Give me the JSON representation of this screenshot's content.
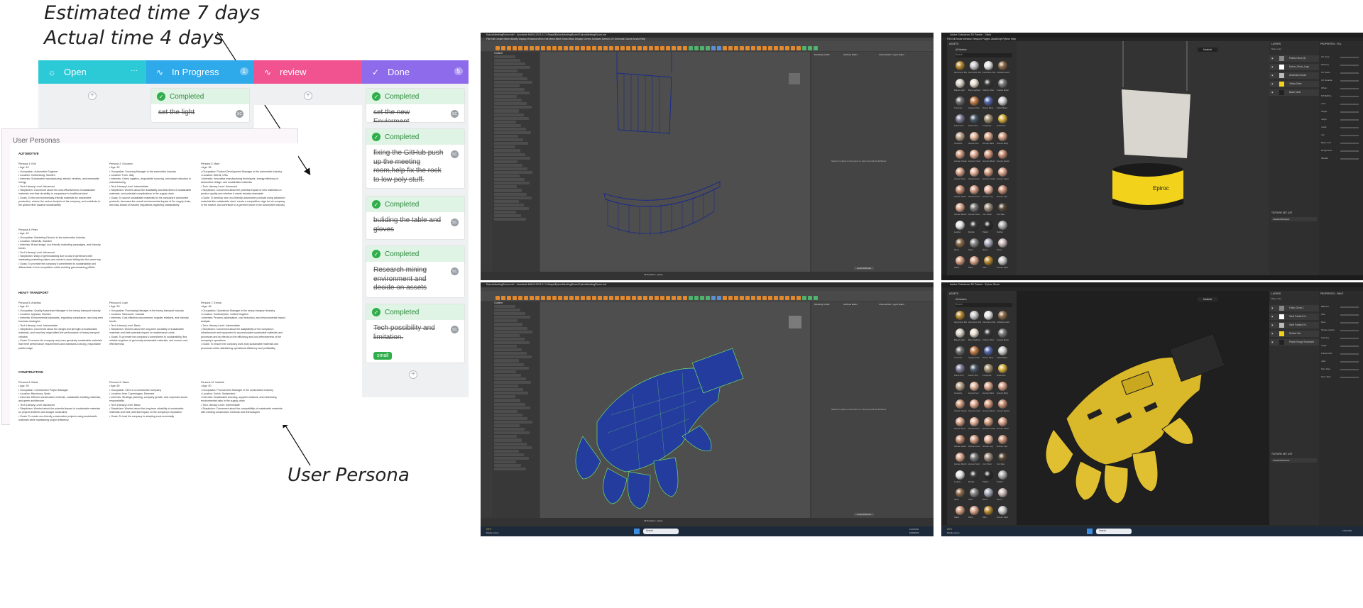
{
  "annotations": {
    "estimated": "Estimated time  7 days",
    "actual": "Actual time 4 days",
    "persona_caption": "User Persona"
  },
  "kanban": {
    "columns": [
      {
        "title": "Open",
        "count": "",
        "color": "#2cc9d6",
        "icon": "sun-icon",
        "menu": "···"
      },
      {
        "title": "In Progress",
        "count": "1",
        "color": "#2ea9ea",
        "icon": "activity-icon"
      },
      {
        "title": "review",
        "count": "",
        "color": "#f0538f",
        "icon": "activity-icon"
      },
      {
        "title": "Done",
        "count": "5",
        "color": "#8e6bea",
        "icon": "check-circle-icon"
      }
    ],
    "status_label": "Completed",
    "in_progress_card": "set the light",
    "done_cards": [
      "set the new Enviorment",
      "fixing the GitHub push up the meeting room,help fix the rock to low poly stuff.",
      "buliding the table and gloves",
      "Research mining environment and decide on assets",
      "Tech possibility and limitation."
    ],
    "tag": "small",
    "avatar": "SC",
    "accent_check": "#2fae4b"
  },
  "personas_doc": {
    "title": "User Personas",
    "sections": [
      {
        "name": "AUTOMOTIVE",
        "personas": [
          {
            "head": "Persona 1: Erik",
            "lines": [
              "Age: 43",
              "Occupation: Automotive Engineer",
              "Location: Gothenburg, Sweden",
              "Interests: Sustainable manufacturing, electric vehicles, and renewable energy",
              "Tech Literacy Level: Advanced",
              "Skepticism: Concerned about the cost-effectiveness of sustainable materials and their durability in comparison to traditional steel",
              "Goals: To find environmentally-friendly materials for automotive production, reduce the carbon footprint of his company, and contribute to the global effort towards sustainability"
            ]
          },
          {
            "head": "Persona 2: Giovanni",
            "lines": [
              "Age: 52",
              "Occupation: Sourcing Manager in the automotive industry",
              "Location: Turin, Italy",
              "Interests: Green logistics, responsible sourcing, and waste reduction in manufacturing",
              "Tech Literacy Level: Intermediate",
              "Skepticism: Worried about the availability and lead times of sustainable materials, and potential complications in the supply chain",
              "Goals: To source sustainable materials for his company's automotive products, decrease the overall environmental impact of the supply chain, and stay ahead of industry regulations regarding sustainability"
            ]
          },
          {
            "head": "Persona 3: Mark",
            "lines": [
              "Age: 38",
              "Occupation: Product Development Manager in the automotive industry",
              "Location: Detroit, USA",
              "Interests: Innovative manufacturing techniques, energy efficiency in automotive design, and sustainable materials",
              "Tech Literacy Level: Advanced",
              "Skepticism: Concerned about the potential impact of new materials on product quality and whether it meets industry standards",
              "Goals: To develop new, eco-friendly automotive products using advanced materials like sustainable steel, create a competitive edge for his company in the market, and contribute to a greener future in the automotive industry"
            ]
          },
          {
            "head": "Persona 4: Peter",
            "lines": [
              "Age: 49",
              "Occupation: Marketing Director in the automotive industry",
              "Location: Västerås, Sweden",
              "Interests: Brand image, eco-friendly marketing campaigns, and industry trends",
              "Tech Literacy Level: Advanced",
              "Skepticism: Wary of greenwashing due to past experiences with misleading marketing claims and wants to avoid falling into the same trap",
              "Goals: To promote the company's commitment to sustainability and differentiate it from competitors while avoiding greenwashing pitfalls"
            ]
          }
        ]
      },
      {
        "name": "HEAVY TRANSPORT",
        "personas": [
          {
            "head": "Persona 5: Andreas",
            "lines": [
              "Age: 44",
              "Occupation: Quality Assurance Manager in the heavy transport industry",
              "Location: Uppsala, Sweden",
              "Interests: Environmental standards, regulatory compliance, and long-term business strategies",
              "Tech Literacy Level: Intermediate",
              "Skepticism: Concerned about the weight and strength of sustainable materials, and how they might affect the performance of heavy transport vehicles",
              "Goals: To ensure his company only uses genuinely sustainable materials that meet performance requirements and maintains a strong, responsible public image"
            ]
          },
          {
            "head": "Persona 6: Liam",
            "lines": [
              "Age: 53",
              "Occupation: Purchasing Manager in the heavy transport industry",
              "Location: Vancouver, Canada",
              "Interests: Cost-effective procurement, supplier relations, and industry trends",
              "Tech Literacy Level: Basic",
              "Skepticism: Worried about the long-term durability of sustainable materials and their potential impact on maintenance costs",
              "Goals: To promote the company's commitment to sustainability, find reliable suppliers of genuinely sustainable materials, and ensure cost-effectiveness"
            ]
          },
          {
            "head": "Persona 7: Emma",
            "lines": [
              "Age: 46",
              "Occupation: Operations Manager in the heavy transport industry",
              "Location: Southampton, United Kingdom",
              "Interests: Process optimization, cost reduction, and environmental impact analysis",
              "Tech Literacy Level: Intermediate",
              "Skepticism: Concerned about the adaptability of the company's infrastructure and equipment to accommodate sustainable materials and processes and its effects on the efficiency and cost-effectiveness of the company's operations",
              "Goals: To ensure her company uses truly sustainable materials and processes while maintaining operational efficiency and profitability"
            ]
          }
        ]
      },
      {
        "name": "CONSTRUCTION",
        "personas": [
          {
            "head": "Persona 8: Maria",
            "lines": [
              "Age: 39",
              "Occupation: Construction Project Manager",
              "Location: Barcelona, Spain",
              "Interests: Efficient construction methods, sustainable building materials, and green architecture",
              "Tech Literacy Level: Advanced",
              "Skepticism: Worried about the potential impact of sustainable materials on project timelines and budget constraints",
              "Goals: To create eco-friendly construction projects using sustainable materials while maintaining project efficiency"
            ]
          },
          {
            "head": "Persona 9: Søren",
            "lines": [
              "Age: 60",
              "Occupation: CEO of a construction company",
              "Location: Aner Copenhagen, Denmark",
              "Interests: Strategic planning, company growth, and corporate social responsibility",
              "Tech Literacy Level: Basic",
              "Skepticism: Worried about the long-term reliability of sustainable materials and their potential impact on the company's reputation",
              "Goals: To lead his company in adopting environmentally"
            ]
          },
          {
            "head": "Persona 10: Isabelle",
            "lines": [
              "Age: 50",
              "Occupation: Procurement Manager in the construction industry",
              "Location: Zurich, Switzerland",
              "Interests: Sustainable sourcing, supplier relations, and minimizing environmental risks in the supply chain",
              "Tech Literacy Level: Intermediate",
              "Skepticism: Concerned about the compatibility of sustainable materials with existing construction methods and technologies"
            ]
          }
        ]
      }
    ]
  },
  "maya": {
    "title": "EpirocMeetingRoom.mb* - Autodesk MAYA 2023.3: D:\\Maya\\EpirocMeetingRoom\\EpirocMeetingRoom.mb",
    "menu": [
      "File",
      "Edit",
      "Create",
      "Select",
      "Modify",
      "Display",
      "Windows",
      "Mesh",
      "Edit Mesh",
      "Mesh Tools",
      "Mesh Display",
      "Curves",
      "Surfaces",
      "Deform",
      "UV",
      "Generate",
      "Cache",
      "Arnold",
      "Help"
    ],
    "workspace": "Modeling - Standard",
    "outliner": "Outliner",
    "attr_tabs": [
      "Modeling Toolkit",
      "Attribute Editor",
      "Channel Box / Layer Editor"
    ],
    "attr_hint": "Select an object to the scene to view and edit its attributes",
    "load_attributes": "Load Attributes",
    "status": "All Positions : persp",
    "search": "Search",
    "time": "12:00 PM",
    "date": "5/18/2023",
    "weather": "23°C",
    "weather_cond": "Mostly sunny"
  },
  "painter": {
    "title": "Adobe Substance 3D Painter - Table",
    "title2": "Adobe Substance 3D Painter - Epiroc Glove",
    "menu": [
      "File",
      "Edit",
      "Mode",
      "Window",
      "Viewport",
      "Plugins",
      "JavaScript",
      "Python",
      "Help"
    ],
    "assets": "ASSETS",
    "library": "All libraries",
    "search": "Search",
    "layers": "LAYERS",
    "properties": "PROPERTIES - FILL",
    "properties2": "PROPERTIES - PAINT",
    "texture_set": "TEXTURE SET LIST",
    "texture_item": "standardSurface1",
    "material": "Material",
    "base_color": "Base color",
    "table_layers": [
      "Plastic Glove (5)",
      "Epiroc_Glove_Logo",
      "Aluminium Brush",
      "Yellow Table",
      "Black Table"
    ],
    "glove_layers": [
      "Fabric Glove 1",
      "Steel Painted Ye..",
      "Steel Painted Ye..",
      "Rubber Dirt",
      "Plastic Rough Scratched"
    ],
    "epiroc_logo": "Epiroc",
    "props_table": [
      "UV wrap",
      "Filtering",
      "UV Scale",
      "UV Rotation",
      "Offset",
      "MATERIAL",
      "color",
      "height",
      "rough",
      "metal",
      "nrm",
      "Base color",
      "Roughness",
      "Metallic"
    ],
    "props_glove": [
      "BRUSH",
      "Size",
      "Flow",
      "Stroke opacity",
      "Spacing",
      "Angle",
      "Follow Path",
      "Jitter",
      "Size Jitter",
      "Flow Jitter"
    ],
    "materials": [
      "Aluminium Brushed",
      "Aluminium Dirty",
      "Aluminium Raw",
      "Artificial Leather",
      "Baked Light",
      "Bone Stylized",
      "Carbon Fiber",
      "Coated Metal",
      "Concrete",
      "Copper Pure",
      "Denim Rivet",
      "Fabric Base",
      "Fabric Knit",
      "Fabric Suit",
      "Footprints",
      "Gold Pure",
      "Gouache",
      "Human Arm",
      "Human Back",
      "Human Belly",
      "Human Cheek",
      "Human Chest",
      "Human Elbow",
      "Human Eyelid",
      "Human Face",
      "Human Feet",
      "Human Forehead",
      "Human Hand",
      "Human Head",
      "Human Knee",
      "Human Leg",
      "Human Lips",
      "Human Mouth",
      "Human Neck",
      "Iron Chain",
      "Iron Raw",
      "Leather",
      "Marble",
      "Plastic",
      "Rubber",
      "Silver",
      "Steel",
      "Wood",
      "Stone",
      "Glass",
      "Paint",
      "Skin",
      "Human Palm"
    ],
    "search_placeholder": "Search",
    "time": "12:01 PM",
    "temp": "23°C",
    "weather": "Mostly sunny"
  }
}
